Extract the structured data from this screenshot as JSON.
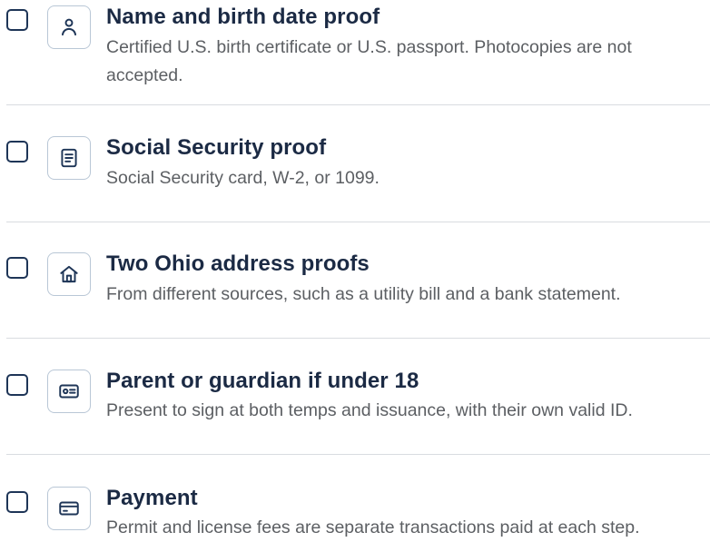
{
  "checklist": {
    "items": [
      {
        "title": "Name and birth date proof",
        "description": "Certified U.S. birth certificate or U.S. passport. Photocopies are not accepted.",
        "icon": "person-icon",
        "checked": false
      },
      {
        "title": "Social Security proof",
        "description": "Social Security card, W-2, or 1099.",
        "icon": "document-icon",
        "checked": false
      },
      {
        "title": "Two Ohio address proofs",
        "description": "From different sources, such as a utility bill and a bank statement.",
        "icon": "home-icon",
        "checked": false
      },
      {
        "title": "Parent or guardian if under 18",
        "description": "Present to sign at both temps and issuance, with their own valid ID.",
        "icon": "id-card-icon",
        "checked": false
      },
      {
        "title": "Payment",
        "description": "Permit and license fees are separate transactions paid at each step.",
        "icon": "credit-card-icon",
        "checked": false
      }
    ]
  },
  "colors": {
    "title": "#1b2a44",
    "description": "#5c5f63",
    "checkbox_border": "#1e3557",
    "icon_stroke": "#1e3557",
    "icon_tile_border": "#b9c7d6",
    "divider": "#d9dce0"
  }
}
